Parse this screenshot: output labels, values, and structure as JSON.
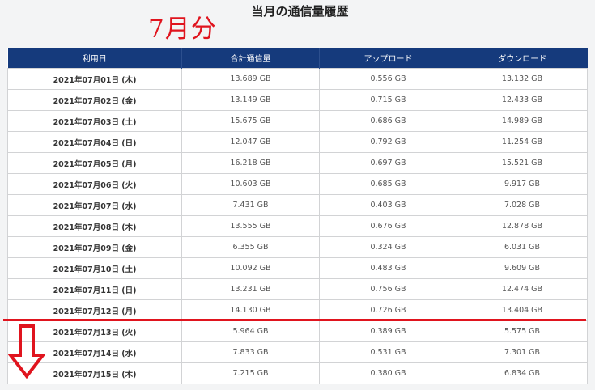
{
  "annotation": "7月分",
  "page_title": "当月の通信量履歴",
  "table": {
    "headers": [
      "利用日",
      "合計通信量",
      "アップロード",
      "ダウンロード"
    ],
    "rows": [
      {
        "date": "2021年07月01日 (木)",
        "total": "13.689 GB",
        "upload": "0.556 GB",
        "download": "13.132 GB"
      },
      {
        "date": "2021年07月02日 (金)",
        "total": "13.149 GB",
        "upload": "0.715 GB",
        "download": "12.433 GB"
      },
      {
        "date": "2021年07月03日 (土)",
        "total": "15.675 GB",
        "upload": "0.686 GB",
        "download": "14.989 GB"
      },
      {
        "date": "2021年07月04日 (日)",
        "total": "12.047 GB",
        "upload": "0.792 GB",
        "download": "11.254 GB"
      },
      {
        "date": "2021年07月05日 (月)",
        "total": "16.218 GB",
        "upload": "0.697 GB",
        "download": "15.521 GB"
      },
      {
        "date": "2021年07月06日 (火)",
        "total": "10.603 GB",
        "upload": "0.685 GB",
        "download": "9.917 GB"
      },
      {
        "date": "2021年07月07日 (水)",
        "total": "7.431 GB",
        "upload": "0.403 GB",
        "download": "7.028 GB"
      },
      {
        "date": "2021年07月08日 (木)",
        "total": "13.555 GB",
        "upload": "0.676 GB",
        "download": "12.878 GB"
      },
      {
        "date": "2021年07月09日 (金)",
        "total": "6.355 GB",
        "upload": "0.324 GB",
        "download": "6.031 GB"
      },
      {
        "date": "2021年07月10日 (土)",
        "total": "10.092 GB",
        "upload": "0.483 GB",
        "download": "9.609 GB"
      },
      {
        "date": "2021年07月11日 (日)",
        "total": "13.231 GB",
        "upload": "0.756 GB",
        "download": "12.474 GB"
      },
      {
        "date": "2021年07月12日 (月)",
        "total": "14.130 GB",
        "upload": "0.726 GB",
        "download": "13.404 GB"
      },
      {
        "date": "2021年07月13日 (火)",
        "total": "5.964 GB",
        "upload": "0.389 GB",
        "download": "5.575 GB"
      },
      {
        "date": "2021年07月14日 (水)",
        "total": "7.833 GB",
        "upload": "0.531 GB",
        "download": "7.301 GB"
      },
      {
        "date": "2021年07月15日 (木)",
        "total": "7.215 GB",
        "upload": "0.380 GB",
        "download": "6.834 GB"
      }
    ]
  },
  "colors": {
    "header_bg": "#153a7c",
    "annotation_red": "#e0141e",
    "border": "#d2d3d5"
  },
  "icons": {
    "down_arrow": "down-arrow-icon"
  }
}
